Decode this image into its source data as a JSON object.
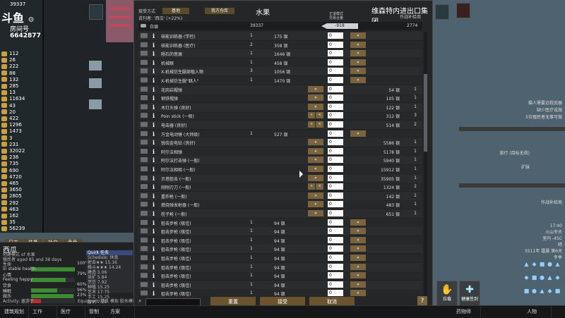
{
  "overlay": {
    "logo": "斗鱼",
    "room_label": "房间号",
    "room_id": "6642877",
    "top_count": "39337"
  },
  "resources": [
    {
      "value": "112"
    },
    {
      "value": "26"
    },
    {
      "value": "222"
    },
    {
      "value": "88"
    },
    {
      "value": "132"
    },
    {
      "value": "285"
    },
    {
      "value": "13"
    },
    {
      "value": "11634"
    },
    {
      "value": "43"
    },
    {
      "value": "20"
    },
    {
      "value": "422"
    },
    {
      "value": "1296"
    },
    {
      "value": "1473"
    },
    {
      "value": "3"
    },
    {
      "value": "231"
    },
    {
      "value": "32022"
    },
    {
      "value": "236"
    },
    {
      "value": "735"
    },
    {
      "value": "690"
    },
    {
      "value": "4720"
    },
    {
      "value": "465"
    },
    {
      "value": "3650"
    },
    {
      "value": "2805"
    },
    {
      "value": "292"
    },
    {
      "value": "463"
    },
    {
      "value": "162"
    },
    {
      "value": "35"
    },
    {
      "value": "56239"
    }
  ],
  "left_tabs": [
    "日志",
    "装备",
    "社交",
    "角色"
  ],
  "character": {
    "name": "西瓜",
    "line1": "创建模式 of 水果",
    "line2": "殖民者 aged 85 and 38 days",
    "bars": [
      {
        "label": "生命",
        "value": "100%",
        "fill": 100,
        "color": "#3c8a32"
      },
      {
        "label": "In stable health",
        "value": "",
        "fill": 0,
        "color": "#3c8a32"
      },
      {
        "label": "心情",
        "value": "79%",
        "fill": 79,
        "color": "#3c8a32"
      },
      {
        "label": "Feeling happy",
        "value": "",
        "fill": 0,
        "color": "#3c8a32"
      },
      {
        "label": "饮食",
        "value": "60%",
        "fill": 60,
        "color": "#3c8a32"
      },
      {
        "label": "睡眠",
        "value": "96%",
        "fill": 96,
        "color": "#3c8a32"
      },
      {
        "label": "娱乐",
        "value": "23%",
        "fill": 23,
        "color": "#b03030"
      }
    ],
    "side_header": "Quirk 任务",
    "side_lines": [
      "Schedule: 休息",
      "射击★★ 15.16",
      "格斗★★★ 14.24",
      "建造 5.06",
      "采矿 5.84",
      "烹饪 7.92",
      "种植 15.25",
      "艺术 17.75",
      "手工 15.25",
      "智识 7.25"
    ],
    "activity": "Activity: 遨游于",
    "equipped": "Equipped: 精良 模拟 胶水模板"
  },
  "dialog": {
    "tab1": "接受方式",
    "btn_main": "基地",
    "btn_left": "我方仓库",
    "label_sub": "说刊者: '西瓜' (+22%)",
    "title_left": "水果",
    "title_right": "维森特内进出口集团",
    "subtitle_right": "作战补给商",
    "col_head": "正道模式\n交易合量",
    "silver": {
      "name": "白银",
      "left": "39337",
      "center": "-918",
      "right": "2774"
    },
    "rows": [
      {
        "name": "核能训练器 (学控)",
        "cnt1": "1",
        "price1": "175 银",
        "q": "0",
        "right": true,
        "left": false,
        "price2": "",
        "cnt2": ""
      },
      {
        "name": "核能训练器 (医疗)",
        "cnt1": "2",
        "price1": "358 银",
        "q": "0",
        "right": true,
        "left": false,
        "price2": "",
        "cnt2": ""
      },
      {
        "name": "陨石的意屑",
        "cnt1": "1",
        "price1": "1646 银",
        "q": "0",
        "right": true,
        "left": false,
        "price2": "",
        "cnt2": ""
      },
      {
        "name": "机械眼",
        "cnt1": "1",
        "price1": "458 银",
        "q": "0",
        "right": true,
        "left": false,
        "price2": "",
        "cnt2": ""
      },
      {
        "name": "X-机械仿生腿部植入物",
        "cnt1": "3",
        "price1": "1056 银",
        "q": "0",
        "right": true,
        "left": false,
        "price2": "",
        "cnt2": ""
      },
      {
        "name": "X-机械仿生腿\"跳人\"",
        "cnt1": "1",
        "price1": "1470 银",
        "q": "0",
        "right": true,
        "left": false,
        "price2": "",
        "cnt2": ""
      },
      {
        "name": "花岗岩帽弹",
        "cnt1": "",
        "price1": "",
        "q": "0",
        "right": false,
        "left": true,
        "price2": "54 银",
        "cnt2": "1"
      },
      {
        "name": "钢铁帽弹",
        "cnt1": "",
        "price1": "",
        "q": "0",
        "right": false,
        "left": true,
        "price2": "105 银",
        "cnt2": "1"
      },
      {
        "name": "木灯头弹 (良好)",
        "cnt1": "",
        "price1": "",
        "q": "0",
        "right": false,
        "left": true,
        "price2": "122 银",
        "cnt2": "1"
      },
      {
        "name": "Poin stick (一般)",
        "cnt1": "",
        "price1": "",
        "q": "0",
        "right": false,
        "left": true,
        "double": true,
        "price2": "312 银",
        "cnt2": "3"
      },
      {
        "name": "电击器 (良好)",
        "cnt1": "",
        "price1": "",
        "q": "0",
        "right": false,
        "left": true,
        "double": true,
        "price2": "514 银",
        "cnt2": "2"
      },
      {
        "name": "万金电动锤 (大师级)",
        "cnt1": "1",
        "price1": "527 银",
        "q": "0",
        "right": true,
        "left": false,
        "price2": "",
        "cnt2": ""
      },
      {
        "name": "锐齿金电钻 (良好)",
        "cnt1": "",
        "price1": "",
        "q": "0",
        "right": false,
        "left": true,
        "price2": "5586 银",
        "cnt2": "1"
      },
      {
        "name": "阿尔法相弹",
        "cnt1": "",
        "price1": "",
        "q": "0",
        "right": false,
        "left": true,
        "price2": "5178 银",
        "cnt2": "1"
      },
      {
        "name": "阿尔法打击弹 (一般)",
        "cnt1": "",
        "price1": "",
        "q": "0",
        "right": false,
        "left": true,
        "price2": "5940 银",
        "cnt2": "1"
      },
      {
        "name": "阿尔法相相 (一般)",
        "cnt1": "",
        "price1": "",
        "q": "0",
        "right": false,
        "left": true,
        "price2": "15912 银",
        "cnt2": "1"
      },
      {
        "name": "贝塔狙击 (一般)",
        "cnt1": "",
        "price1": "",
        "q": "0",
        "right": false,
        "left": true,
        "price2": "35905 银",
        "cnt2": "1"
      },
      {
        "name": "刚刚刃刀 (一般)",
        "cnt1": "",
        "price1": "",
        "q": "0",
        "right": false,
        "left": true,
        "double": true,
        "price2": "1324 银",
        "cnt2": "2"
      },
      {
        "name": "重炸枪 (一般)",
        "cnt1": "",
        "price1": "",
        "q": "0",
        "right": false,
        "left": true,
        "price2": "142 银",
        "cnt2": "1"
      },
      {
        "name": "燃烧弹发射器 (一般)",
        "cnt1": "",
        "price1": "",
        "q": "0",
        "right": false,
        "left": true,
        "price2": "483 银",
        "cnt2": "1"
      },
      {
        "name": "栓子枪 (一般)",
        "cnt1": "",
        "price1": "",
        "q": "0",
        "right": false,
        "left": true,
        "price2": "651 银",
        "cnt2": "1"
      },
      {
        "name": "狙击步枪 (极佳)",
        "cnt1": "1",
        "price1": "94 银",
        "q": "0",
        "right": true,
        "left": false,
        "price2": "",
        "cnt2": ""
      },
      {
        "name": "狙击步枪 (极佳)",
        "cnt1": "1",
        "price1": "94 银",
        "q": "0",
        "right": true,
        "left": false,
        "price2": "",
        "cnt2": ""
      },
      {
        "name": "狙击步枪 (极佳)",
        "cnt1": "1",
        "price1": "94 银",
        "q": "0",
        "right": true,
        "left": false,
        "price2": "",
        "cnt2": ""
      },
      {
        "name": "狙击步枪 (极佳)",
        "cnt1": "1",
        "price1": "94 银",
        "q": "0",
        "right": true,
        "left": false,
        "price2": "",
        "cnt2": ""
      },
      {
        "name": "狙击步枪 (极佳)",
        "cnt1": "1",
        "price1": "94 银",
        "q": "0",
        "right": true,
        "left": false,
        "price2": "",
        "cnt2": ""
      },
      {
        "name": "狙击步枪 (极佳)",
        "cnt1": "1",
        "price1": "94 银",
        "q": "0",
        "right": true,
        "left": false,
        "price2": "",
        "cnt2": ""
      },
      {
        "name": "狙击步枪 (极佳)",
        "cnt1": "1",
        "price1": "94 银",
        "q": "0",
        "right": true,
        "left": false,
        "price2": "",
        "cnt2": ""
      },
      {
        "name": "狙击步枪 (极佳)",
        "cnt1": "1",
        "price1": "94 银",
        "q": "0",
        "right": true,
        "left": false,
        "price2": "",
        "cnt2": ""
      },
      {
        "name": "狙击步枪 (极佳)",
        "cnt1": "1",
        "price1": "94 银",
        "q": "0",
        "right": true,
        "left": false,
        "price2": "",
        "cnt2": ""
      }
    ],
    "footer": {
      "reset": "重置",
      "accept": "接受",
      "cancel": "取消",
      "help": "?"
    }
  },
  "right_panel": {
    "lines": [
      "猫人需要远程武器",
      "缺少医疗设施",
      "5位殖民者无事可做"
    ],
    "misc": [
      "旅行 (目标无效)",
      "矿脉",
      "作战补给商",
      "17:40",
      "火山冬天",
      "室内 -45C",
      "晴",
      "5511年 霜晨 第6天",
      "冬季"
    ]
  },
  "action_buttons": [
    "拉载",
    "健康签到"
  ],
  "menubar": [
    "建筑规划",
    "工作",
    "医疗",
    "管制",
    "方案",
    "药物师",
    "人物"
  ]
}
